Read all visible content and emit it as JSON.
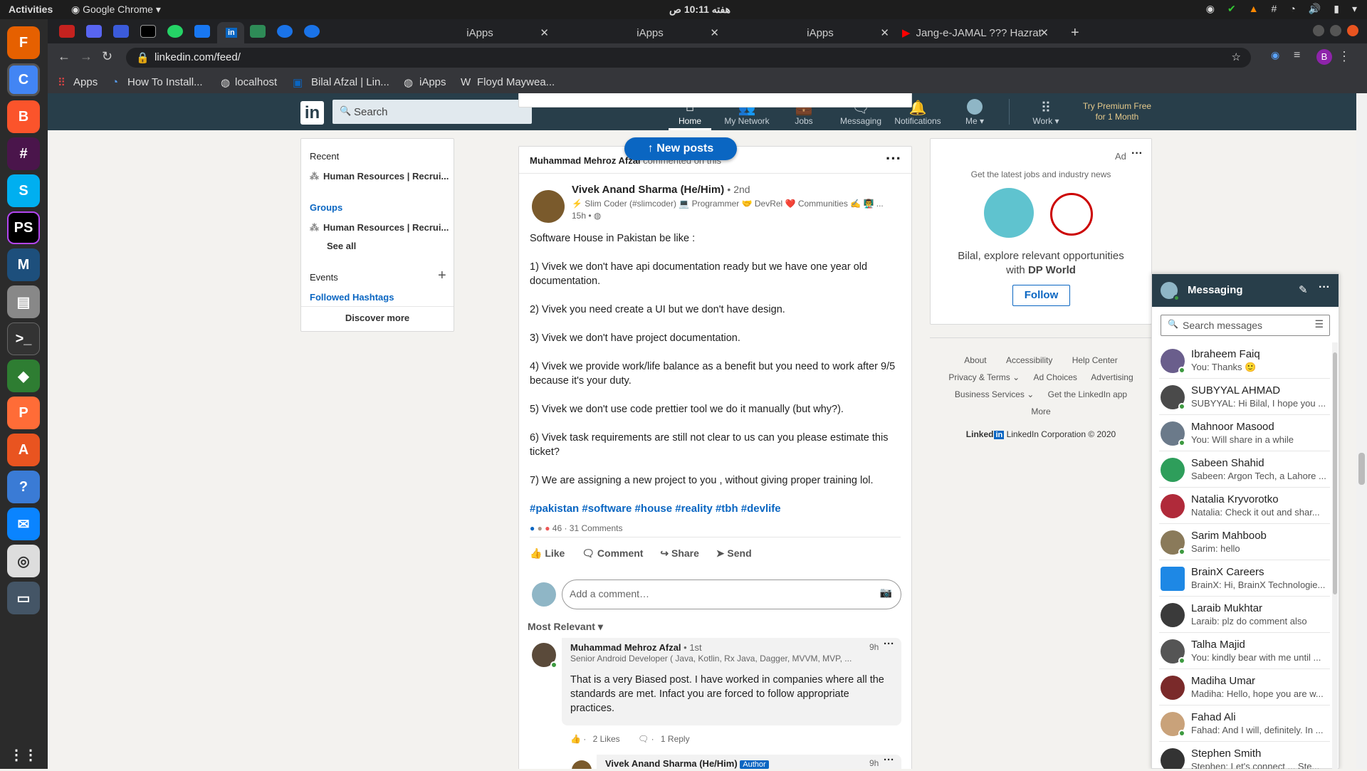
{
  "os": {
    "activities": "Activities",
    "app_name": "Google Chrome",
    "clock": "هفته 10:11 ص"
  },
  "tabs": [
    {
      "label": "iApps"
    },
    {
      "label": "iApps"
    },
    {
      "label": "iApps"
    },
    {
      "label": "Jang-e-JAMAL ??? Hazrat"
    }
  ],
  "omnibox": {
    "url": "linkedin.com/feed/"
  },
  "bookmarks": [
    "Apps",
    "How To Install...",
    "localhost",
    "Bilal Afzal | Lin...",
    "iApps",
    "Floyd Maywea..."
  ],
  "linkedin_nav": {
    "search_placeholder": "Search",
    "items": [
      {
        "label": "Home",
        "icon": "home-icon"
      },
      {
        "label": "My Network",
        "icon": "network-icon"
      },
      {
        "label": "Jobs",
        "icon": "jobs-icon"
      },
      {
        "label": "Messaging",
        "icon": "messaging-icon"
      },
      {
        "label": "Notifications",
        "icon": "bell-icon"
      },
      {
        "label": "Me",
        "icon": "avatar"
      },
      {
        "label": "Work",
        "icon": "grid-icon"
      }
    ],
    "premium_line1": "Try Premium Free",
    "premium_line2": "for 1 Month"
  },
  "left_panel": {
    "recent_title": "Recent",
    "recent_item": "Human Resources | Recrui...",
    "groups_title": "Groups",
    "groups_item": "Human Resources | Recrui...",
    "see_all": "See all",
    "events": "Events",
    "followed_hashtags": "Followed Hashtags",
    "discover_more": "Discover more"
  },
  "new_posts_button": "New posts",
  "post": {
    "activity_actor": "Muhammad Mehroz Afzal",
    "activity_text": "commented on this",
    "author": "Vivek Anand Sharma (He/Him)",
    "degree": "• 2nd",
    "headline": "⚡ Slim Coder (#slimcoder) 💻 Programmer 🤝 DevRel ❤️ Communities ✍️ 👨‍🏫 ...",
    "time": "15h •",
    "lines": [
      "Software House in Pakistan be like :",
      "1) Vivek we don't have api documentation ready but we have one year old documentation.",
      "2) Vivek you need create a UI but we don't have design.",
      "3) Vivek we don't have project documentation.",
      "4) Vivek we provide work/life balance as a benefit but you need to work after 9/5 because it's your duty.",
      "5) Vivek we don't use code prettier tool we do it manually (but why?).",
      "6) Vivek task requirements are still not clear to us can you please estimate this ticket?",
      "7) We are assigning a new project to you , without giving proper training lol."
    ],
    "hashtags": "#pakistan #software #house #reality #tbh #devlife",
    "reactions": "46 · 31 Comments",
    "actions": [
      "Like",
      "Comment",
      "Share",
      "Send"
    ],
    "comment_placeholder": "Add a comment…",
    "sort_label": "Most Relevant",
    "comment": {
      "author": "Muhammad Mehroz Afzal",
      "degree": "• 1st",
      "headline": "Senior Android Developer ( Java, Kotlin, Rx Java, Dagger, MVVM, MVP, ...",
      "time": "9h",
      "text": "That is a very Biased post. I have worked in companies where all the standards are met. Infact you are forced to follow appropriate practices.",
      "likes": "2 Likes",
      "replies": "1 Reply"
    },
    "reply": {
      "author": "Vivek Anand Sharma (He/Him)",
      "badge": "Author",
      "time": "9h"
    }
  },
  "ad": {
    "label": "Ad",
    "tagline": "Get the latest jobs and industry news",
    "explore_line1": "Bilal, explore relevant opportunities",
    "explore_prefix": "with",
    "explore_company": "DP World",
    "follow": "Follow"
  },
  "footer": {
    "links": [
      "About",
      "Accessibility",
      "Help Center",
      "Privacy & Terms",
      "Ad Choices",
      "Advertising",
      "Business Services",
      "Get the LinkedIn app",
      "More"
    ],
    "brand": "Linked",
    "brand_in": "in",
    "copyright": "LinkedIn Corporation © 2020"
  },
  "messaging": {
    "title": "Messaging",
    "search_placeholder": "Search messages",
    "conversations": [
      {
        "name": "Ibraheem Faiq",
        "preview": "You: Thanks 🙂"
      },
      {
        "name": "SUBYYAL AHMAD",
        "preview": "SUBYYAL: Hi Bilal, I hope you ..."
      },
      {
        "name": "Mahnoor Masood",
        "preview": "You: Will share in a while"
      },
      {
        "name": "Sabeen Shahid",
        "preview": "Sabeen: Argon Tech, a Lahore ..."
      },
      {
        "name": "Natalia Kryvorotko",
        "preview": "Natalia: Check it out and shar..."
      },
      {
        "name": "Sarim Mahboob",
        "preview": "Sarim: hello"
      },
      {
        "name": "BrainX Careers",
        "preview": "BrainX: Hi, BrainX Technologie..."
      },
      {
        "name": "Laraib Mukhtar",
        "preview": "Laraib: plz do comment also"
      },
      {
        "name": "Talha Majid",
        "preview": "You: kindly bear with me until ..."
      },
      {
        "name": "Madiha Umar",
        "preview": "Madiha: Hello, hope you are w..."
      },
      {
        "name": "Fahad Ali",
        "preview": "Fahad: And I will, definitely. In ..."
      },
      {
        "name": "Stephen Smith",
        "preview": "Stephen: Let's connect ... Ste..."
      }
    ]
  }
}
